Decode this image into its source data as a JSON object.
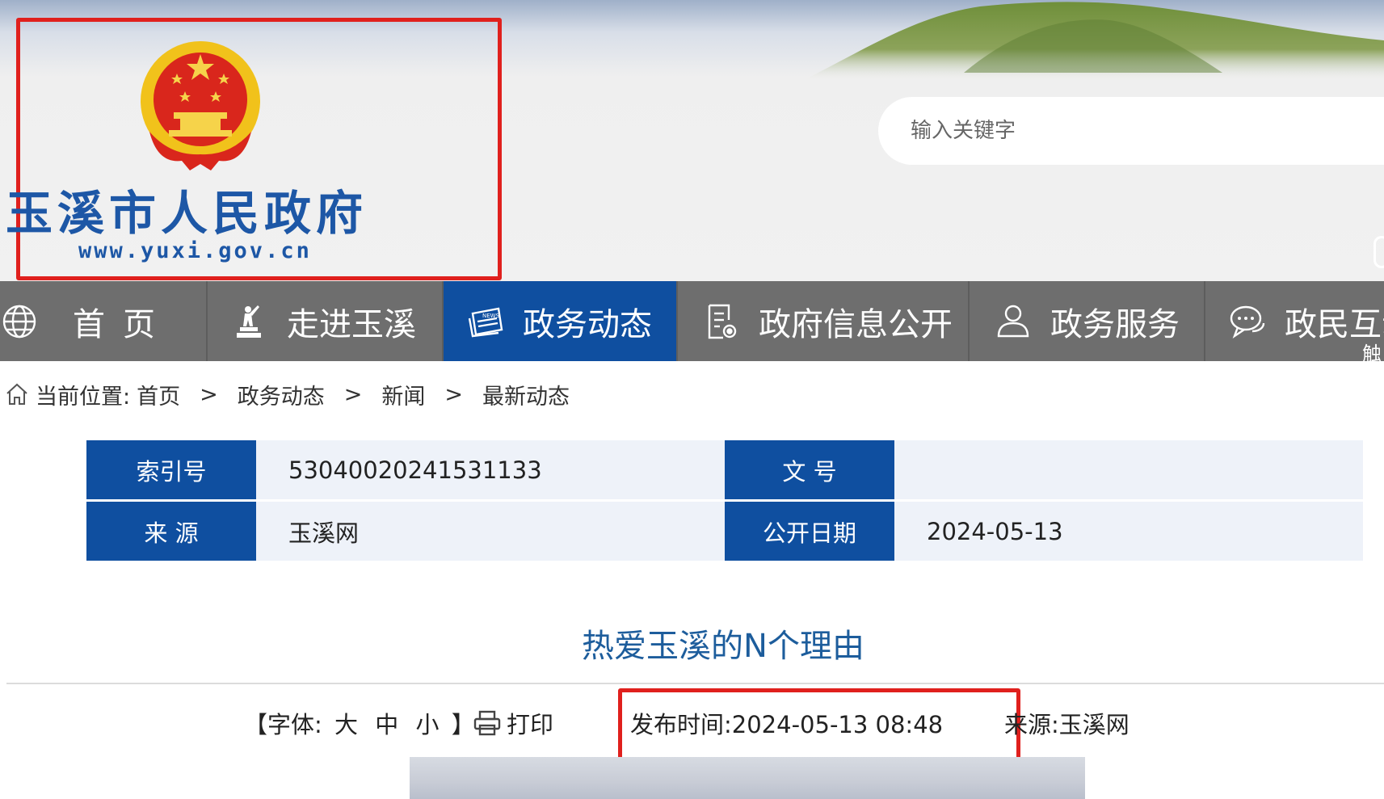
{
  "header": {
    "site_name": "玉溪市人民政府",
    "site_url": "www.yuxi.gov.cn",
    "search_placeholder": "输入关键字"
  },
  "nav": {
    "items": [
      {
        "label": "首页",
        "icon": "globe-icon"
      },
      {
        "label": "走进玉溪",
        "icon": "statue-icon"
      },
      {
        "label": "政务动态",
        "icon": "newspaper-icon",
        "active": true
      },
      {
        "label": "政府信息公开",
        "icon": "document-icon"
      },
      {
        "label": "政务服务",
        "icon": "person-icon"
      },
      {
        "label": "政民互动",
        "icon": "chat-icon"
      }
    ],
    "touch_label": "触"
  },
  "breadcrumb": {
    "prefix": "当前位置:",
    "items": [
      "首页",
      "政务动态",
      "新闻",
      "最新动态"
    ],
    "separator": ">"
  },
  "info_table": {
    "index_label": "索引号",
    "index_value": "53040020241531133",
    "doc_no_label": "文 号",
    "doc_no_value": "",
    "source_label": "来 源",
    "source_value": "玉溪网",
    "date_label": "公开日期",
    "date_value": "2024-05-13"
  },
  "article": {
    "title": "热爱玉溪的N个理由",
    "font_label": "【字体:",
    "font_sizes": [
      "大",
      "中",
      "小"
    ],
    "font_close": "】",
    "print_label": "打印",
    "publish_time": "发布时间:2024-05-13 08:48",
    "source": "来源:玉溪网"
  },
  "colors": {
    "nav_background": "#6e6e6e",
    "accent_blue": "#0f4fa0",
    "title_blue": "#1d5d9c",
    "highlight_red": "#e0201d"
  }
}
